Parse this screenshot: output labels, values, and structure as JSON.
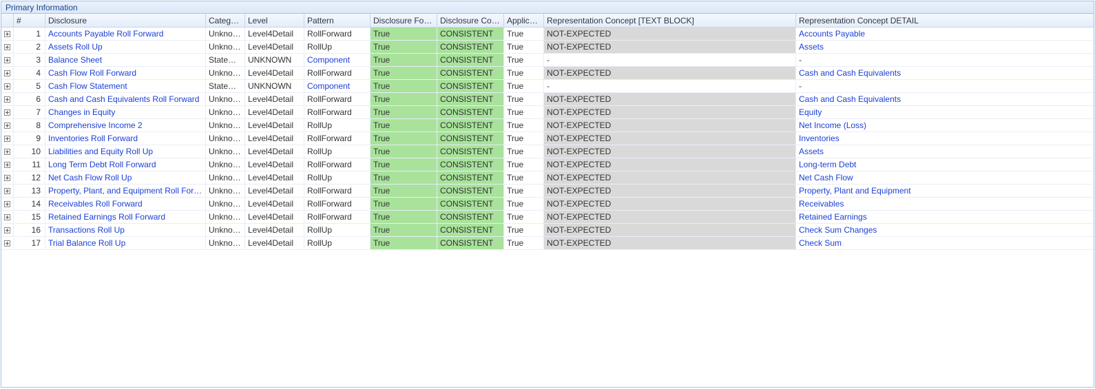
{
  "panel": {
    "title": "Primary Information"
  },
  "columns": {
    "num": "#",
    "disclosure": "Disclosure",
    "category": "Category",
    "level": "Level",
    "pattern": "Pattern",
    "found": "Disclosure Found",
    "consistent": "Disclosure Consi...",
    "applicable": "Applicable",
    "textblock": "Representation Concept [TEXT BLOCK]",
    "detail": "Representation Concept DETAIL"
  },
  "rows": [
    {
      "n": 1,
      "disclosure": "Accounts Payable Roll Forward",
      "category": "Unknown",
      "level": "Level4Detail",
      "pattern": "RollForward",
      "pattern_link": false,
      "found": "True",
      "cons": "CONSISTENT",
      "app": "True",
      "txt": "NOT-EXPECTED",
      "txt_grey": true,
      "detail": "Accounts Payable",
      "detail_link": true
    },
    {
      "n": 2,
      "disclosure": "Assets Roll Up",
      "category": "Unknown",
      "level": "Level4Detail",
      "pattern": "RollUp",
      "pattern_link": false,
      "found": "True",
      "cons": "CONSISTENT",
      "app": "True",
      "txt": "NOT-EXPECTED",
      "txt_grey": true,
      "detail": "Assets",
      "detail_link": true
    },
    {
      "n": 3,
      "disclosure": "Balance Sheet",
      "category": "Statement",
      "level": "UNKNOWN",
      "pattern": "Component",
      "pattern_link": true,
      "found": "True",
      "cons": "CONSISTENT",
      "app": "True",
      "txt": "-",
      "txt_grey": false,
      "detail": "-",
      "detail_link": false
    },
    {
      "n": 4,
      "disclosure": "Cash Flow Roll Forward",
      "category": "Unknown",
      "level": "Level4Detail",
      "pattern": "RollForward",
      "pattern_link": false,
      "found": "True",
      "cons": "CONSISTENT",
      "app": "True",
      "txt": "NOT-EXPECTED",
      "txt_grey": true,
      "detail": "Cash and Cash Equivalents",
      "detail_link": true
    },
    {
      "n": 5,
      "disclosure": "Cash Flow Statement",
      "category": "Statement",
      "level": "UNKNOWN",
      "pattern": "Component",
      "pattern_link": true,
      "found": "True",
      "cons": "CONSISTENT",
      "app": "True",
      "txt": "-",
      "txt_grey": false,
      "detail": "-",
      "detail_link": false
    },
    {
      "n": 6,
      "disclosure": "Cash and Cash Equivalents Roll Forward",
      "category": "Unknown",
      "level": "Level4Detail",
      "pattern": "RollForward",
      "pattern_link": false,
      "found": "True",
      "cons": "CONSISTENT",
      "app": "True",
      "txt": "NOT-EXPECTED",
      "txt_grey": true,
      "detail": "Cash and Cash Equivalents",
      "detail_link": true
    },
    {
      "n": 7,
      "disclosure": "Changes in Equity",
      "category": "Unknown",
      "level": "Level4Detail",
      "pattern": "RollForward",
      "pattern_link": false,
      "found": "True",
      "cons": "CONSISTENT",
      "app": "True",
      "txt": "NOT-EXPECTED",
      "txt_grey": true,
      "detail": "Equity",
      "detail_link": true
    },
    {
      "n": 8,
      "disclosure": "Comprehensive Income 2",
      "category": "Unknown",
      "level": "Level4Detail",
      "pattern": "RollUp",
      "pattern_link": false,
      "found": "True",
      "cons": "CONSISTENT",
      "app": "True",
      "txt": "NOT-EXPECTED",
      "txt_grey": true,
      "detail": "Net Income (Loss)",
      "detail_link": true
    },
    {
      "n": 9,
      "disclosure": "Inventories Roll Forward",
      "category": "Unknown",
      "level": "Level4Detail",
      "pattern": "RollForward",
      "pattern_link": false,
      "found": "True",
      "cons": "CONSISTENT",
      "app": "True",
      "txt": "NOT-EXPECTED",
      "txt_grey": true,
      "detail": "Inventories",
      "detail_link": true
    },
    {
      "n": 10,
      "disclosure": "Liabilities and Equity Roll Up",
      "category": "Unknown",
      "level": "Level4Detail",
      "pattern": "RollUp",
      "pattern_link": false,
      "found": "True",
      "cons": "CONSISTENT",
      "app": "True",
      "txt": "NOT-EXPECTED",
      "txt_grey": true,
      "detail": "Assets",
      "detail_link": true
    },
    {
      "n": 11,
      "disclosure": "Long Term Debt Roll Forward",
      "category": "Unknown",
      "level": "Level4Detail",
      "pattern": "RollForward",
      "pattern_link": false,
      "found": "True",
      "cons": "CONSISTENT",
      "app": "True",
      "txt": "NOT-EXPECTED",
      "txt_grey": true,
      "detail": "Long-term Debt",
      "detail_link": true
    },
    {
      "n": 12,
      "disclosure": "Net Cash Flow Roll Up",
      "category": "Unknown",
      "level": "Level4Detail",
      "pattern": "RollUp",
      "pattern_link": false,
      "found": "True",
      "cons": "CONSISTENT",
      "app": "True",
      "txt": "NOT-EXPECTED",
      "txt_grey": true,
      "detail": "Net Cash Flow",
      "detail_link": true
    },
    {
      "n": 13,
      "disclosure": "Property, Plant, and Equipment Roll Forward",
      "category": "Unknown",
      "level": "Level4Detail",
      "pattern": "RollForward",
      "pattern_link": false,
      "found": "True",
      "cons": "CONSISTENT",
      "app": "True",
      "txt": "NOT-EXPECTED",
      "txt_grey": true,
      "detail": "Property, Plant and Equipment",
      "detail_link": true
    },
    {
      "n": 14,
      "disclosure": "Receivables Roll Forward",
      "category": "Unknown",
      "level": "Level4Detail",
      "pattern": "RollForward",
      "pattern_link": false,
      "found": "True",
      "cons": "CONSISTENT",
      "app": "True",
      "txt": "NOT-EXPECTED",
      "txt_grey": true,
      "detail": "Receivables",
      "detail_link": true
    },
    {
      "n": 15,
      "disclosure": "Retained Earnings Roll Forward",
      "category": "Unknown",
      "level": "Level4Detail",
      "pattern": "RollForward",
      "pattern_link": false,
      "found": "True",
      "cons": "CONSISTENT",
      "app": "True",
      "txt": "NOT-EXPECTED",
      "txt_grey": true,
      "detail": "Retained Earnings",
      "detail_link": true
    },
    {
      "n": 16,
      "disclosure": "Transactions Roll Up",
      "category": "Unknown",
      "level": "Level4Detail",
      "pattern": "RollUp",
      "pattern_link": false,
      "found": "True",
      "cons": "CONSISTENT",
      "app": "True",
      "txt": "NOT-EXPECTED",
      "txt_grey": true,
      "detail": "Check Sum Changes",
      "detail_link": true
    },
    {
      "n": 17,
      "disclosure": "Trial Balance Roll Up",
      "category": "Unknown",
      "level": "Level4Detail",
      "pattern": "RollUp",
      "pattern_link": false,
      "found": "True",
      "cons": "CONSISTENT",
      "app": "True",
      "txt": "NOT-EXPECTED",
      "txt_grey": true,
      "detail": "Check Sum",
      "detail_link": true
    }
  ]
}
